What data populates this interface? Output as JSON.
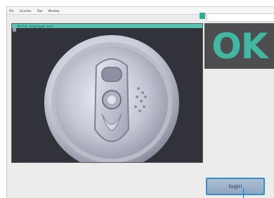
{
  "menu": {
    "items": [
      {
        "label": "File"
      },
      {
        "label": "Function"
      },
      {
        "label": "Tool"
      },
      {
        "label": "Window"
      }
    ]
  },
  "image_pane": {
    "caption": "Define displayed unit"
  },
  "status": {
    "result": "OK",
    "result_color": "#41b8a2"
  },
  "actions": {
    "login_label": "login"
  }
}
